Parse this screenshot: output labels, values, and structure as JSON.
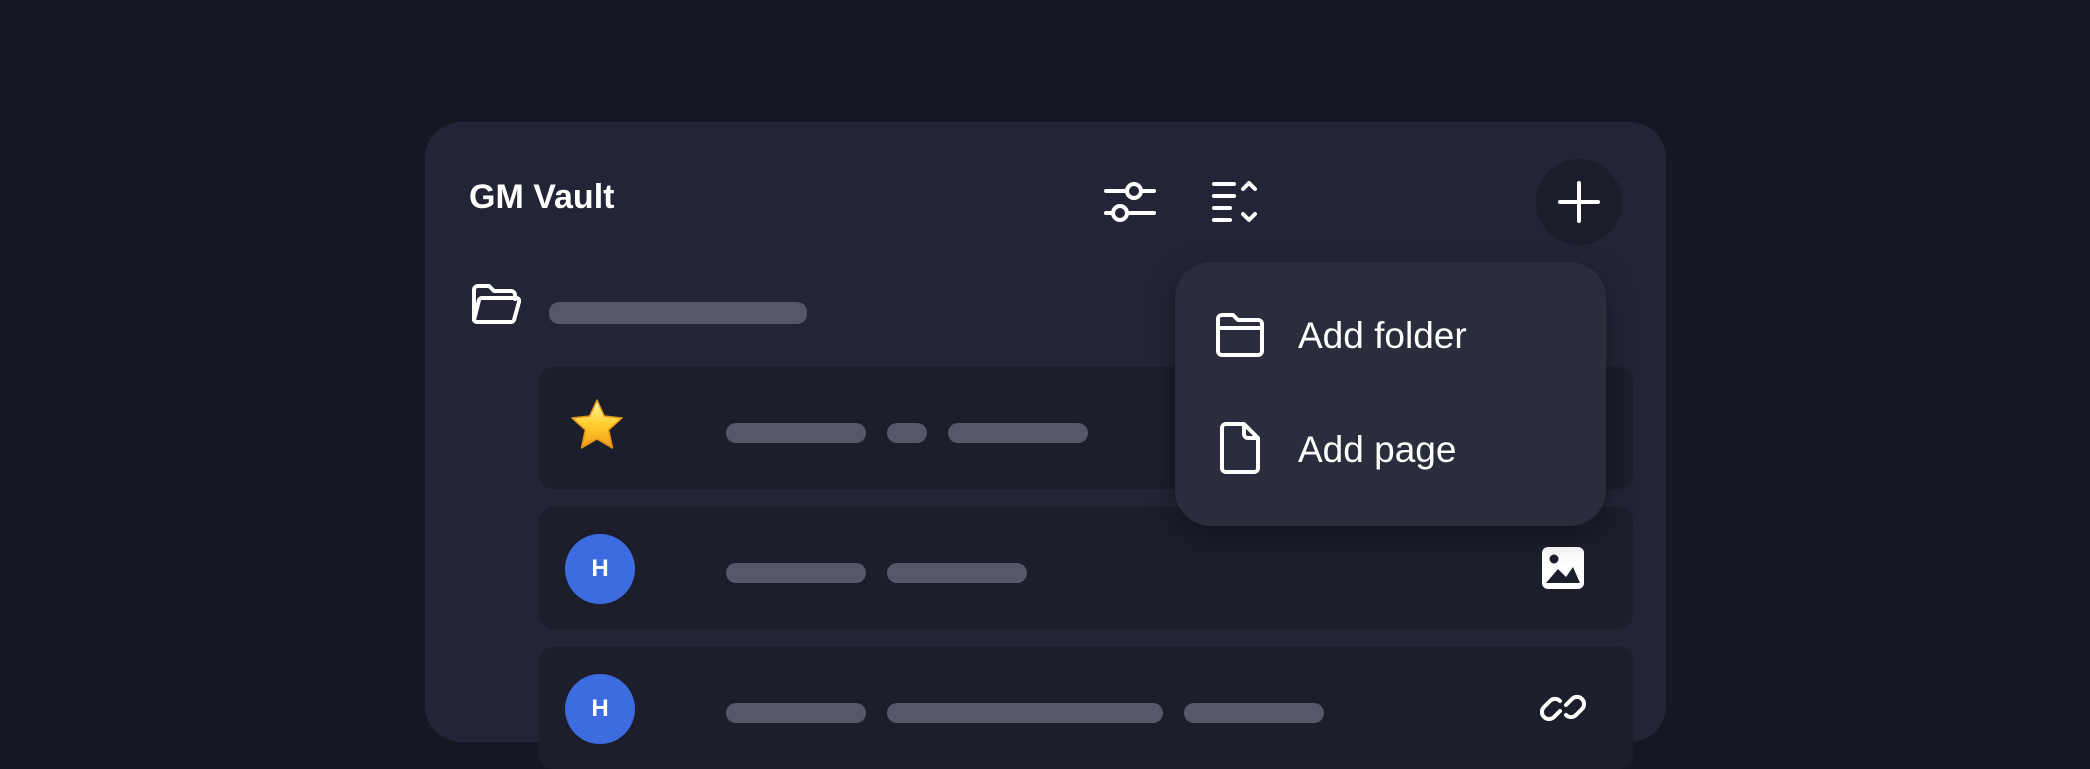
{
  "app": {
    "title": "GM Vault"
  },
  "toolbar": {
    "filter_icon": "sliders-icon",
    "sort_icon": "sort-list-icon",
    "add_icon": "plus-icon"
  },
  "add_menu": {
    "items": [
      {
        "label": "Add folder",
        "icon": "folder-icon"
      },
      {
        "label": "Add page",
        "icon": "page-icon"
      }
    ]
  },
  "list": {
    "rows": [
      {
        "leading": "star-icon",
        "action": ""
      },
      {
        "avatar": "H",
        "action": "image-icon"
      },
      {
        "avatar": "H",
        "action": "link-icon"
      }
    ]
  },
  "colors": {
    "background": "#151722",
    "panel": "#232536",
    "row": "#1c1e2c",
    "menu": "#2b2d3d",
    "avatar": "#3d6be0",
    "skeleton": "#555868"
  }
}
